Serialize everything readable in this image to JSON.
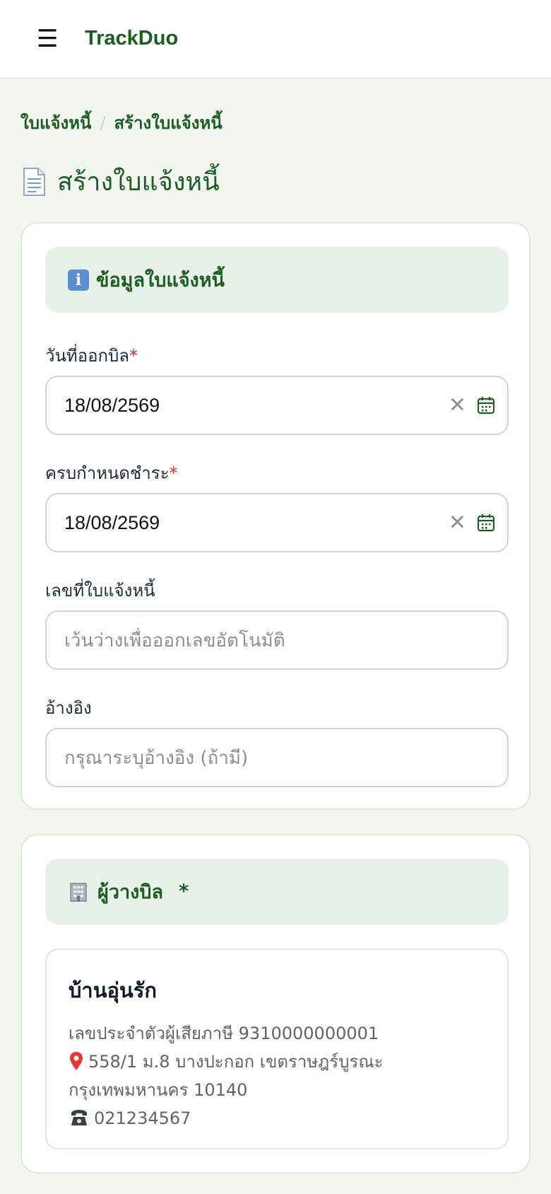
{
  "header": {
    "menu_icon": "hamburger-icon",
    "brand": "TrackDuo"
  },
  "breadcrumb": {
    "parent": "ใบแจ้งหนี้",
    "separator": "/",
    "current": "สร้างใบแจ้งหนี้"
  },
  "page": {
    "title_icon": "document-icon",
    "title": "สร้างใบแจ้งหนี้"
  },
  "invoice_info": {
    "section_icon": "info-icon",
    "section_title": "ข้อมูลใบแจ้งหนี้",
    "issue_date": {
      "label": "วันที่ออกบิล",
      "required_mark": "*",
      "value": "18/08/2569"
    },
    "due_date": {
      "label": "ครบกำหนดชำระ",
      "required_mark": "*",
      "value": "18/08/2569"
    },
    "invoice_number": {
      "label": "เลขที่ใบแจ้งหนี้",
      "placeholder": "เว้นว่างเพื่อออกเลขอัตโนมัติ"
    },
    "reference": {
      "label": "อ้างอิง",
      "placeholder": "กรุณาระบุอ้างอิง (ถ้ามี)"
    }
  },
  "biller": {
    "section_icon": "building-icon",
    "section_title": "ผู้วางบิล",
    "required_mark": "*",
    "name": "บ้านอุ่นรัก",
    "tax_id_line": "เลขประจำตัวผู้เสียภาษี 9310000000001",
    "address_line1": "558/1 ม.8 บางปะกอก เขตราษฎร์บูรณะ",
    "address_line2": "กรุงเทพมหานคร 10140",
    "phone": "021234567"
  },
  "colors": {
    "brand_green": "#1b5e20",
    "section_bg": "#e8f0ea",
    "required_red": "#d32f2f",
    "page_bg": "#f3f5f1"
  }
}
